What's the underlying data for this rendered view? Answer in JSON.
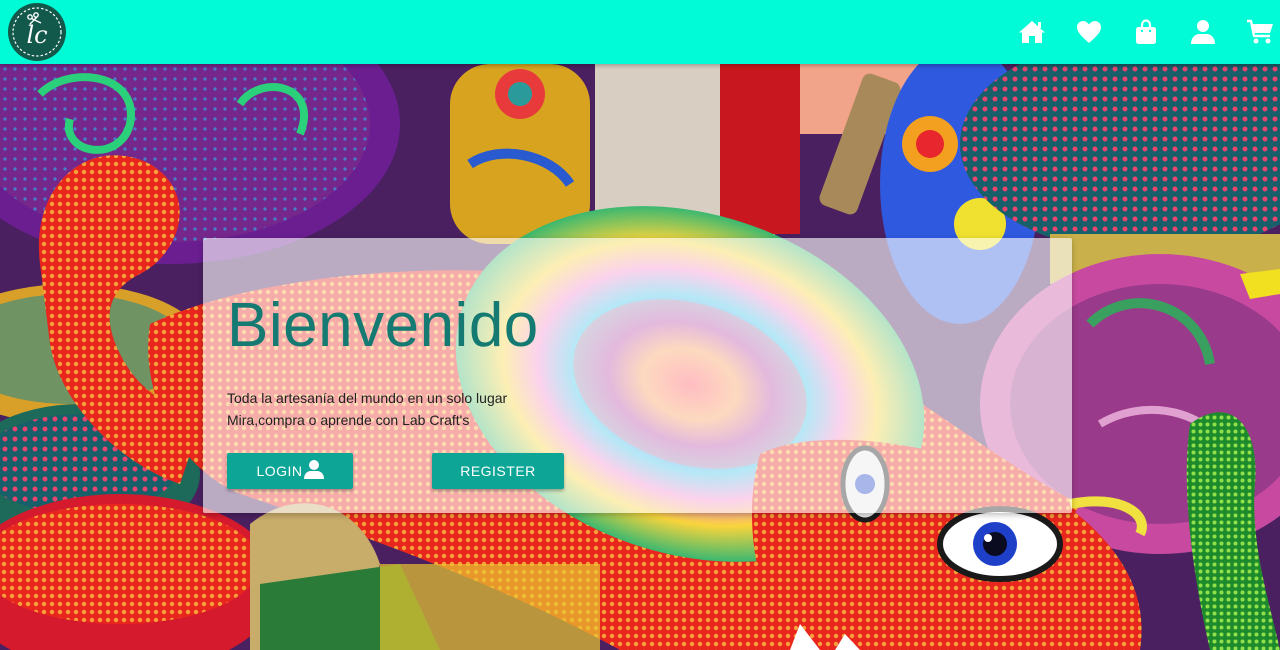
{
  "navbar": {
    "logo_icon": "lc-scissors-logo",
    "icons": [
      {
        "name": "home-icon"
      },
      {
        "name": "heart-icon"
      },
      {
        "name": "shopping-bag-icon"
      },
      {
        "name": "user-icon"
      },
      {
        "name": "cart-icon"
      }
    ]
  },
  "hero": {
    "title": "Bienvenido",
    "line1": "Toda la artesanía del mundo en un solo lugar",
    "line2": "Mira,compra o aprende con Lab Craft's",
    "login_label": "LOGIN",
    "register_label": "REGISTER"
  },
  "colors": {
    "navbar": "#00fbd6",
    "title": "#147a72",
    "button": "#0da596",
    "logo": "#12594b"
  }
}
